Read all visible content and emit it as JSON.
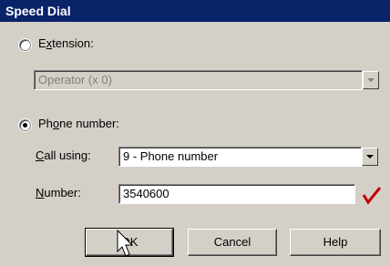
{
  "window": {
    "title": "Speed Dial"
  },
  "extension": {
    "label_pre": "E",
    "label_u": "x",
    "label_post": "tension:",
    "selected_value": "Operator (x 0)"
  },
  "phone": {
    "label_pre": "Ph",
    "label_u": "o",
    "label_post": "ne number:",
    "call_using_label_u": "C",
    "call_using_label_post": "all using:",
    "call_using_value": "9 - Phone number",
    "number_label_u": "N",
    "number_label_post": "umber:",
    "number_value": "3540600"
  },
  "buttons": {
    "ok": "OK",
    "cancel": "Cancel",
    "help": "Help"
  },
  "colors": {
    "title_bar": "#0a246a",
    "check_mark": "#c00000",
    "face": "#d4d0c8"
  }
}
